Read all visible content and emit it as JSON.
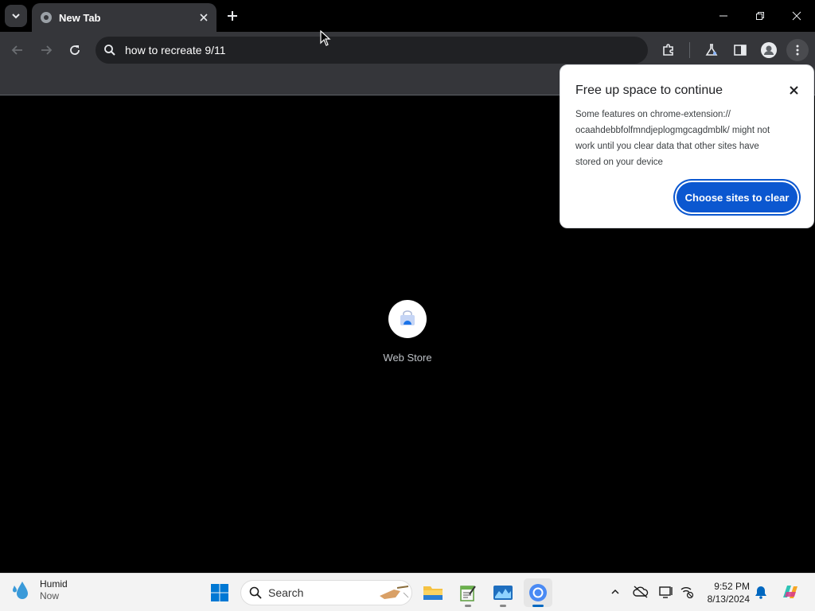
{
  "tab": {
    "title": "New Tab"
  },
  "omnibox": {
    "text": "how to recreate 9/11"
  },
  "shortcut": {
    "label": "Web Store"
  },
  "popup": {
    "title": "Free up space to continue",
    "body_lines": [
      "Some features on chrome-extension://",
      "ocaahdebbfolfmndjeplogmgcagdmblk/ might not",
      "work until you clear data that other sites have",
      "stored on your device"
    ],
    "button_label": "Choose sites to clear"
  },
  "taskbar": {
    "weather_title": "Humid",
    "weather_sub": "Now",
    "search_label": "Search",
    "time": "9:52 PM",
    "date": "8/13/2024"
  },
  "colors": {
    "accent": "#0b57d0",
    "toolbar": "#35363a",
    "omnibox": "#202124"
  }
}
